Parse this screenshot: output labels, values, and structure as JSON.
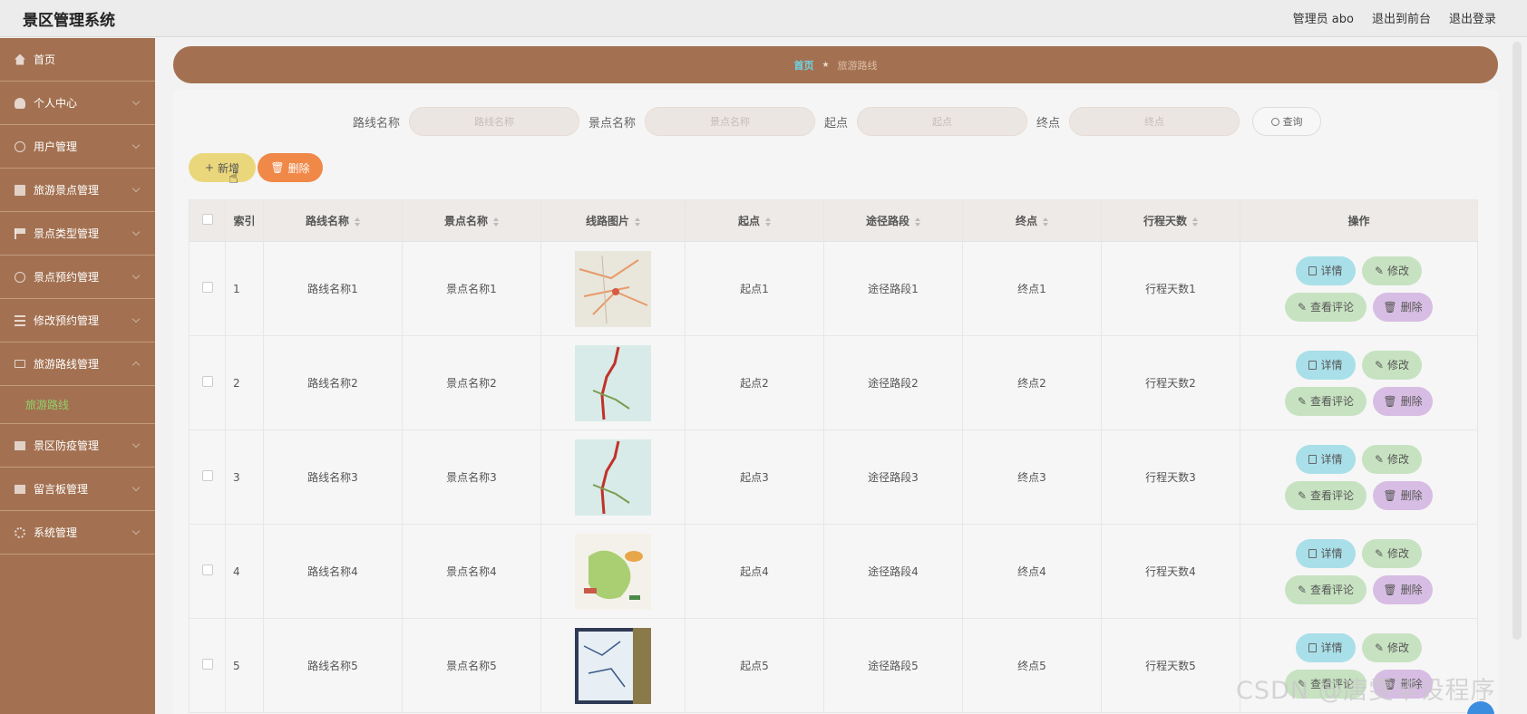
{
  "app": {
    "title": "景区管理系统",
    "user_label": "管理员 abo",
    "to_front_label": "退出到前台",
    "logout_label": "退出登录"
  },
  "sidebar": {
    "items": [
      {
        "label": "首页",
        "icon": "home-icon"
      },
      {
        "label": "个人中心",
        "icon": "user-icon"
      },
      {
        "label": "用户管理",
        "icon": "user-circle-icon"
      },
      {
        "label": "旅游景点管理",
        "icon": "document-icon"
      },
      {
        "label": "景点类型管理",
        "icon": "flag-icon"
      },
      {
        "label": "景点预约管理",
        "icon": "clock-icon"
      },
      {
        "label": "修改预约管理",
        "icon": "list-icon"
      },
      {
        "label": "旅游路线管理",
        "icon": "mail-icon"
      },
      {
        "label": "景区防疫管理",
        "icon": "box-icon"
      },
      {
        "label": "留言板管理",
        "icon": "chart-icon"
      },
      {
        "label": "系统管理",
        "icon": "gear-icon"
      }
    ],
    "sub_item": "旅游路线"
  },
  "breadcrumb": {
    "home": "首页",
    "current": "旅游路线"
  },
  "search": {
    "route_label": "路线名称",
    "route_placeholder": "路线名称",
    "spot_label": "景点名称",
    "spot_placeholder": "景点名称",
    "start_label": "起点",
    "start_placeholder": "起点",
    "end_label": "终点",
    "end_placeholder": "终点",
    "query_label": "查询"
  },
  "actions": {
    "add_label": "新增",
    "delete_label": "删除"
  },
  "table": {
    "columns": [
      "索引",
      "路线名称",
      "景点名称",
      "线路图片",
      "起点",
      "途径路段",
      "终点",
      "行程天数",
      "操作"
    ],
    "rows": [
      {
        "index": "1",
        "route": "路线名称1",
        "spot": "景点名称1",
        "start": "起点1",
        "via": "途径路段1",
        "end": "终点1",
        "days": "行程天数1"
      },
      {
        "index": "2",
        "route": "路线名称2",
        "spot": "景点名称2",
        "start": "起点2",
        "via": "途径路段2",
        "end": "终点2",
        "days": "行程天数2"
      },
      {
        "index": "3",
        "route": "路线名称3",
        "spot": "景点名称3",
        "start": "起点3",
        "via": "途径路段3",
        "end": "终点3",
        "days": "行程天数3"
      },
      {
        "index": "4",
        "route": "路线名称4",
        "spot": "景点名称4",
        "start": "起点4",
        "via": "途径路段4",
        "end": "终点4",
        "days": "行程天数4"
      },
      {
        "index": "5",
        "route": "路线名称5",
        "spot": "景点名称5",
        "start": "起点5",
        "via": "途径路段5",
        "end": "终点5",
        "days": "行程天数5"
      }
    ],
    "op_labels": {
      "detail": "详情",
      "edit": "修改",
      "comment": "查看评论",
      "delete": "删除"
    }
  },
  "watermark": "CSDN @唐雯毕设程序",
  "colors": {
    "sidebar_bg": "#a37151",
    "accent_green": "#8fd16a",
    "btn_add": "#ead77c",
    "btn_delete": "#f08848",
    "op_detail": "#a9dfe9",
    "op_edit": "#c7e2c1",
    "op_delete": "#d7bde3"
  }
}
